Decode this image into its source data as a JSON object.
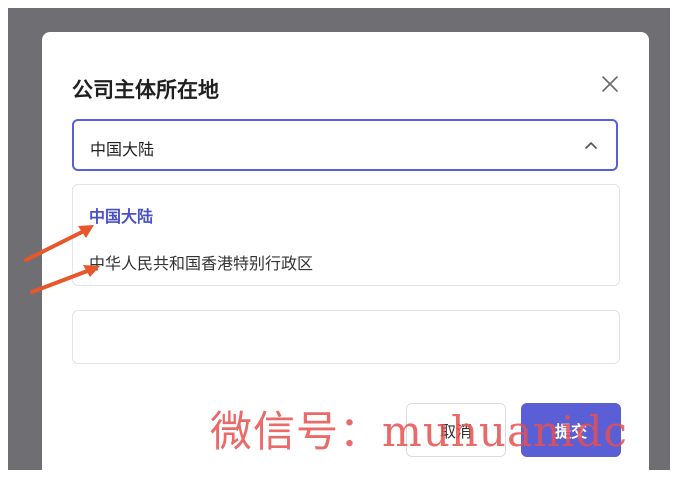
{
  "modal": {
    "title": "公司主体所在地",
    "close_icon": "close-icon"
  },
  "select": {
    "value": "中国大陆",
    "chevron_icon": "chevron-up-icon",
    "options": [
      {
        "label": "中国大陆",
        "selected": true
      },
      {
        "label": "中华人民共和国香港特别行政区",
        "selected": false
      }
    ]
  },
  "buttons": {
    "cancel_label": "取消",
    "submit_label": "提交"
  },
  "watermark": {
    "text": "微信号：muhuanidc"
  },
  "colors": {
    "accent": "#5b5fd6",
    "selected_text": "#4b4fc8",
    "arrow": "#e8562a",
    "backdrop": "#6e6e73"
  }
}
